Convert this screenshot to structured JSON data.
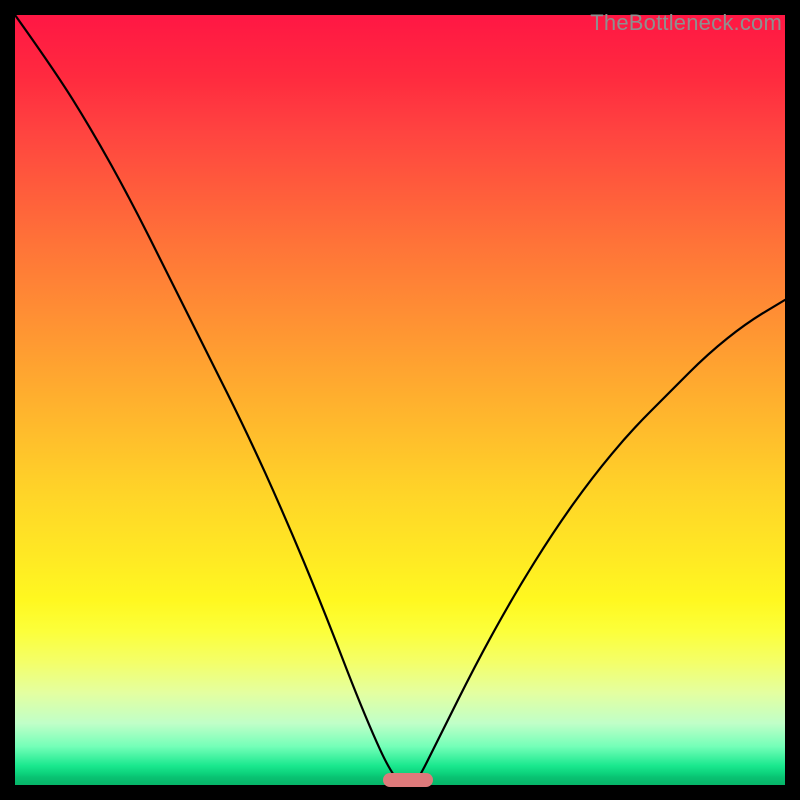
{
  "watermark": "TheBottleneck.com",
  "chart_data": {
    "type": "line",
    "title": "",
    "xlabel": "",
    "ylabel": "",
    "xlim": [
      0,
      100
    ],
    "ylim": [
      0,
      100
    ],
    "grid": false,
    "background": "rainbow-gradient-red-to-green",
    "series": [
      {
        "name": "bottleneck-curve",
        "x": [
          0,
          5,
          10,
          15,
          20,
          25,
          30,
          35,
          40,
          45,
          49,
          51,
          52,
          55,
          60,
          65,
          70,
          75,
          80,
          85,
          90,
          95,
          100
        ],
        "values": [
          100,
          93,
          85,
          76,
          66,
          56,
          46,
          35,
          23,
          10,
          1,
          0,
          0,
          6,
          16,
          25,
          33,
          40,
          46,
          51,
          56,
          60,
          63
        ]
      }
    ],
    "marker": {
      "x": 51,
      "y": 0,
      "color": "#de7a7b",
      "shape": "pill"
    }
  }
}
